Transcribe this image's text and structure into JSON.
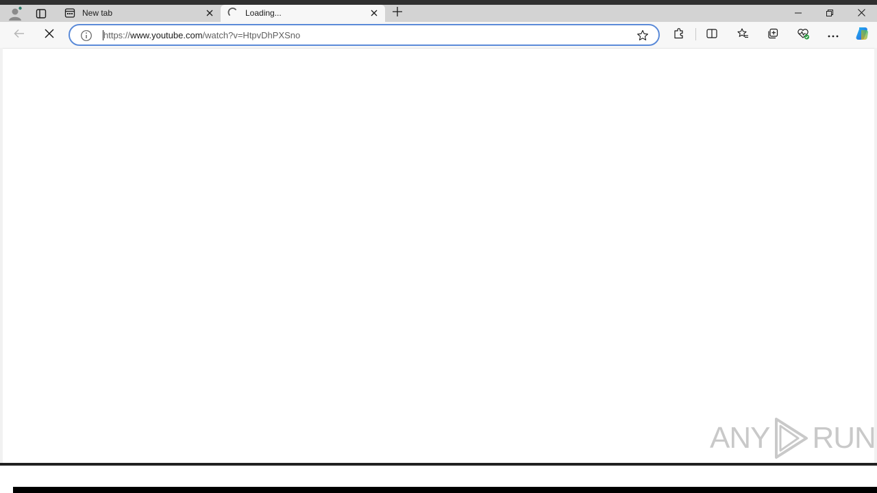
{
  "browser": {
    "tabs": [
      {
        "title": "New tab",
        "state": "inactive"
      },
      {
        "title": "Loading...",
        "state": "active-loading"
      }
    ],
    "window_controls": [
      "minimize",
      "restore",
      "close"
    ]
  },
  "toolbar": {
    "url_scheme": "https://",
    "url_host": "www.youtube.com",
    "url_path": "/watch?v=HtpvDhPXSno"
  },
  "watermark": {
    "left": "ANY",
    "right": "RUN"
  },
  "icons": {
    "profile": "profile-icon",
    "workspaces": "workspaces-icon",
    "newtab_favicon": "newtab-favicon-icon",
    "loading_spinner": "loading-spinner-icon",
    "close_tab": "close-icon",
    "new_tab": "plus-icon",
    "back": "back-arrow-icon",
    "stop": "stop-icon",
    "site_info": "info-icon",
    "favorite_add": "star-icon",
    "extensions": "extensions-icon",
    "split_screen": "split-screen-icon",
    "favorites": "favorites-icon",
    "collections": "collections-icon",
    "browser_essentials": "heart-pulse-icon",
    "more": "more-icon",
    "copilot": "copilot-icon"
  },
  "colors": {
    "address_border": "#5a8ad8",
    "tabstrip_bg": "#d3d3d3",
    "toolbar_bg": "#f7f7f7",
    "essentials_badge": "#2e9e45"
  }
}
